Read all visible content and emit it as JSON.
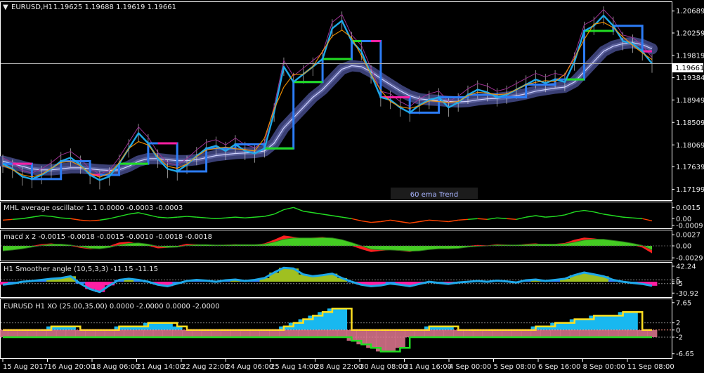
{
  "header": {
    "symbol_label": "EURUSD,H1",
    "ohlc": "1.19625 1.19688 1.19619 1.19661",
    "menu_glyph": "▼"
  },
  "trend_label": "60 ema Trend",
  "price_tag": "1.19661",
  "colors": {
    "background": "#000000",
    "axis": "#ffffff",
    "price_cyan": "#1fa8e8",
    "price_blue": "#2c7cf6",
    "band": "#3a3f74",
    "band_core": "#cfd3ff",
    "magenta": "#ff1fa3",
    "orange": "#ff9900",
    "green": "#22dd22",
    "red_orange": "#ff4400",
    "olive": "#a0c020",
    "yellow": "#ffe020",
    "pink": "#e07890"
  },
  "chart_data": [
    {
      "type": "line",
      "title": "EURUSD,H1  1.19625 1.19688 1.19619 1.19661",
      "ylim": [
        1.17,
        1.2085
      ],
      "y_ticks": [
        "1.20689",
        "1.20259",
        "1.19819",
        "1.19384",
        "1.18949",
        "1.18509",
        "1.18069",
        "1.17639",
        "1.17199"
      ],
      "last_price": "1.19661",
      "x_ticks": [
        "15 Aug 2017",
        "16 Aug 20:00",
        "18 Aug 06:00",
        "21 Aug 14:00",
        "22 Aug 22:00",
        "24 Aug 06:00",
        "25 Aug 14:00",
        "28 Aug 22:00",
        "30 Aug 08:00",
        "31 Aug 16:00",
        "4 Sep 00:00",
        "5 Sep 08:00",
        "6 Sep 16:00",
        "8 Sep 00:00",
        "11 Sep 08:00"
      ],
      "series": [
        {
          "values": [
            1.177,
            1.176,
            1.1745,
            1.174,
            1.1748,
            1.176,
            1.1775,
            1.1782,
            1.1768,
            1.1748,
            1.1738,
            1.1745,
            1.177,
            1.18,
            1.183,
            1.181,
            1.178,
            1.176,
            1.1755,
            1.1768,
            1.1785,
            1.18,
            1.1805,
            1.1795,
            1.1808,
            1.1795,
            1.179,
            1.18,
            1.187,
            1.196,
            1.193,
            1.1945,
            1.196,
            1.1975,
            1.2035,
            1.205,
            1.201,
            1.199,
            1.1945,
            1.19,
            1.1895,
            1.188,
            1.187,
            1.1885,
            1.1895,
            1.19,
            1.188,
            1.189,
            1.1905,
            1.1915,
            1.191,
            1.19,
            1.1905,
            1.1915,
            1.1925,
            1.1935,
            1.1928,
            1.1935,
            1.193,
            1.197,
            1.203,
            1.204,
            1.206,
            1.204,
            1.201,
            1.2005,
            1.199,
            1.1966
          ]
        },
        {
          "values": [
            1.1775,
            1.177,
            1.1765,
            1.176,
            1.1758,
            1.1758,
            1.176,
            1.1762,
            1.1762,
            1.176,
            1.1758,
            1.1757,
            1.1758,
            1.1765,
            1.1775,
            1.178,
            1.178,
            1.1778,
            1.1776,
            1.1776,
            1.1778,
            1.1782,
            1.1786,
            1.1788,
            1.179,
            1.1791,
            1.1792,
            1.1795,
            1.181,
            1.184,
            1.186,
            1.188,
            1.19,
            1.1915,
            1.1935,
            1.1955,
            1.1962,
            1.196,
            1.195,
            1.1937,
            1.1925,
            1.1913,
            1.1903,
            1.1897,
            1.1895,
            1.1894,
            1.1892,
            1.1891,
            1.1892,
            1.1895,
            1.1897,
            1.1898,
            1.19,
            1.1903,
            1.1907,
            1.1912,
            1.1915,
            1.1918,
            1.192,
            1.193,
            1.195,
            1.197,
            1.199,
            1.2,
            1.2005,
            1.2007,
            1.2003,
            1.1995
          ]
        }
      ]
    },
    {
      "type": "line",
      "title": "MHL average oscillator 1.1 0.0000 -0.0003 -0.0003",
      "ylim": [
        -0.0012,
        0.002
      ],
      "y_ticks": [
        "0.0015",
        "0.00",
        "-0.0009"
      ],
      "series": [
        {
          "values": [
            -0.0002,
            -0.0001,
            0.0,
            0.0002,
            0.0004,
            0.0003,
            0.0001,
            0.0,
            -0.0002,
            -0.0003,
            -0.0002,
            0.0,
            0.0003,
            0.0006,
            0.0008,
            0.0005,
            0.0002,
            0.0001,
            0.0002,
            0.0003,
            0.0002,
            0.0001,
            0.0,
            0.0001,
            0.0002,
            0.0001,
            0.0002,
            0.0003,
            0.0006,
            0.0012,
            0.0015,
            0.001,
            0.0008,
            0.0006,
            0.0004,
            0.0002,
            0.0,
            -0.0003,
            -0.0005,
            -0.0004,
            -0.0002,
            -0.0004,
            -0.0006,
            -0.0004,
            -0.0002,
            -0.0003,
            -0.0004,
            -0.0002,
            -0.0001,
            0.0,
            -0.0001,
            0.0001,
            0.0,
            -0.0001,
            0.0002,
            0.0004,
            0.0002,
            0.0003,
            0.0005,
            0.0009,
            0.0011,
            0.0009,
            0.0006,
            0.0004,
            0.0002,
            0.0001,
            0.0,
            -0.0003
          ]
        }
      ]
    },
    {
      "type": "area",
      "title": "macd x 2 -0.0015 -0.0018 -0.0015 -0.0010 -0.0018 -0.0018",
      "ylim": [
        -0.0034,
        0.0034
      ],
      "y_ticks": [
        "0.0027",
        "0.00",
        "-0.0029"
      ],
      "series": [
        {
          "values": [
            -0.001,
            -0.0008,
            -0.0005,
            0.0,
            0.0004,
            0.0006,
            0.0003,
            0.0,
            -0.0005,
            -0.0008,
            -0.0006,
            0.0,
            0.0008,
            0.001,
            0.0005,
            0.0,
            -0.0006,
            -0.0005,
            0.0,
            0.0005,
            0.0004,
            0.0002,
            0.0001,
            0.0003,
            0.0004,
            0.0002,
            0.0003,
            0.0006,
            0.0015,
            0.0025,
            0.0022,
            0.0018,
            0.002,
            0.0022,
            0.0018,
            0.001,
            0.0,
            -0.0008,
            -0.0015,
            -0.0012,
            -0.001,
            -0.0012,
            -0.0015,
            -0.001,
            -0.0005,
            -0.0006,
            -0.0008,
            -0.0004,
            0.0,
            0.0002,
            0.0001,
            0.0004,
            0.0003,
            0.0002,
            0.0005,
            0.0006,
            0.0003,
            0.0005,
            0.0007,
            0.0015,
            0.002,
            0.0018,
            0.0015,
            0.001,
            0.0006,
            0.0002,
            -0.0004,
            -0.0018
          ]
        },
        {
          "values": [
            -0.0012,
            -0.001,
            -0.0007,
            -0.0003,
            0.0001,
            0.0004,
            0.0004,
            0.0002,
            -0.0002,
            -0.0006,
            -0.0007,
            -0.0004,
            0.0002,
            0.0006,
            0.0007,
            0.0004,
            -0.0001,
            -0.0004,
            -0.0003,
            0.0001,
            0.0003,
            0.0003,
            0.0002,
            0.0002,
            0.0003,
            0.0003,
            0.0003,
            0.0004,
            0.0009,
            0.0016,
            0.0019,
            0.0019,
            0.0019,
            0.002,
            0.0019,
            0.0015,
            0.0008,
            0.0,
            -0.0008,
            -0.001,
            -0.001,
            -0.0011,
            -0.0013,
            -0.0012,
            -0.0009,
            -0.0007,
            -0.0007,
            -0.0006,
            -0.0003,
            -0.0001,
            0.0,
            0.0002,
            0.0002,
            0.0002,
            0.0003,
            0.0004,
            0.0004,
            0.0004,
            0.0005,
            0.0009,
            0.0014,
            0.0016,
            0.0016,
            0.0013,
            0.001,
            0.0006,
            0.0001,
            -0.001
          ]
        }
      ]
    },
    {
      "type": "bar",
      "title": "H1 Smoother angle (10,5,3,3) -11.15 -11.15",
      "ylim": [
        -40,
        48
      ],
      "y_ticks": [
        "42.24",
        "5",
        "0",
        "-5",
        "-30.92"
      ],
      "series": [
        {
          "values": [
            -8,
            -5,
            0,
            2,
            5,
            8,
            10,
            15,
            -5,
            -20,
            -28,
            -10,
            5,
            8,
            5,
            0,
            -8,
            -12,
            -5,
            2,
            5,
            3,
            0,
            4,
            6,
            2,
            5,
            10,
            25,
            38,
            36,
            20,
            15,
            18,
            22,
            10,
            0,
            -8,
            -12,
            -10,
            -5,
            -8,
            -12,
            -6,
            0,
            -3,
            -6,
            -2,
            0,
            2,
            0,
            3,
            1,
            -2,
            4,
            6,
            2,
            5,
            8,
            18,
            25,
            20,
            15,
            5,
            0,
            -3,
            -6,
            -11
          ]
        }
      ]
    },
    {
      "type": "area",
      "title": "EURUSD H1 XO (25.00,35.00) 0.0000 -2.0000 0.0000 -2.0000",
      "ylim": [
        -7.5,
        8.2
      ],
      "y_ticks": [
        "7.65",
        "2",
        "0",
        "-2",
        "-6.65"
      ],
      "series": [
        {
          "values": [
            0,
            0,
            0,
            0,
            0,
            1,
            1,
            1,
            0,
            0,
            0,
            0,
            1,
            1,
            1,
            2,
            2,
            2,
            1,
            0,
            0,
            0,
            0,
            0,
            0,
            0,
            0,
            0,
            0,
            1,
            2,
            3,
            4,
            5,
            6,
            6,
            0,
            0,
            0,
            0,
            0,
            0,
            0,
            0,
            1,
            1,
            1,
            0,
            0,
            0,
            0,
            0,
            0,
            0,
            0,
            1,
            1,
            2,
            2,
            3,
            3,
            4,
            4,
            4,
            5,
            5,
            0,
            0
          ]
        },
        {
          "values": [
            -2,
            -2,
            -2,
            -2,
            -2,
            -2,
            -2,
            -2,
            -2,
            -2,
            -2,
            -2,
            -2,
            -2,
            -2,
            -2,
            -2,
            -2,
            -2,
            -2,
            -2,
            -2,
            -2,
            -2,
            -2,
            -2,
            -2,
            -2,
            -2,
            -2,
            -2,
            -2,
            -2,
            -2,
            -2,
            -2,
            -3,
            -4,
            -5,
            -6,
            -6,
            -5,
            -2,
            -2,
            -2,
            -2,
            -2,
            -2,
            -2,
            -2,
            -2,
            -2,
            -2,
            -2,
            -2,
            -2,
            -2,
            -2,
            -2,
            -2,
            -2,
            -2,
            -2,
            -2,
            -2,
            -2,
            -2,
            -2
          ]
        }
      ]
    }
  ]
}
